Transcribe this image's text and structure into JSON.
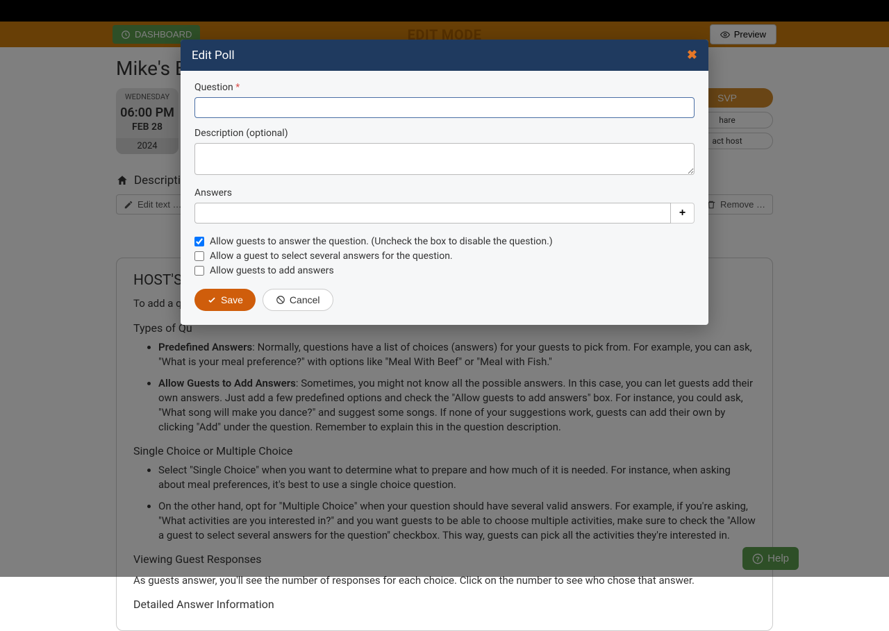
{
  "topBar": {
    "dashboard": "DASHBOARD",
    "editMode": "EDIT MODE",
    "preview": "Preview"
  },
  "page": {
    "title": "Mike's Bir",
    "date": {
      "dow": "WEDNESDAY",
      "time": "06:00 PM",
      "md": "FEB 28",
      "year": "2024"
    },
    "rsvp": {
      "rsvp": "SVP",
      "share": "hare",
      "contact": "act host"
    },
    "descLabel": "Description",
    "toolbar": {
      "edit": "Edit text …",
      "remove": "Remove …"
    }
  },
  "panel": {
    "heading": "HOST'S N",
    "intro": "To add a que",
    "typesHeading": "Types of Qu",
    "li1b": "Predefined Answers",
    "li1": ": Normally, questions have a list of choices (answers) for your guests to pick from. For example, you can ask, \"What is your meal preference?\" with options like \"Meal With Beef\" or \"Meal with Fish.\"",
    "li2b": "Allow Guests to Add Answers",
    "li2": ": Sometimes, you might not know all the possible answers. In this case, you can let guests add their own answers. Just add a few predefined options and check the \"Allow guests to add answers\" box. For instance, you could ask, \"What song will make you dance?\" and suggest some songs. If none of your suggestions work, guests can add their own by clicking \"Add\" under the question. Remember to explain this in the question description.",
    "singleHeading": "Single Choice or Multiple Choice",
    "li3": "Select \"Single Choice\" when you want to determine what to prepare and how much of it is needed. For instance, when asking about meal preferences, it's best to use a single choice question.",
    "li4": "On the other hand, opt for \"Multiple Choice\" when your question should have several valid answers. For example, if you're asking, \"What activities are you interested in?\" and you want guests to be able to choose multiple activities, make sure to check the \"Allow a guest to select several answers for the question\" checkbox. This way, guests can pick all the activities they're interested in.",
    "viewingHeading": "Viewing Guest Responses",
    "viewingText": "As guests answer, you'll see the number of responses for each choice. Click on the number to see who chose that answer.",
    "detailedHeading": "Detailed Answer Information"
  },
  "modal": {
    "title": "Edit Poll",
    "questionLabel": "Question",
    "descLabel": "Description (optional)",
    "answersLabel": "Answers",
    "plus": "+",
    "check1": "Allow guests to answer the question. (Uncheck the box to disable the question.)",
    "check2": "Allow a guest to select several answers for the question.",
    "check3": "Allow guests to add answers",
    "save": "Save",
    "cancel": "Cancel"
  },
  "help": "Help"
}
